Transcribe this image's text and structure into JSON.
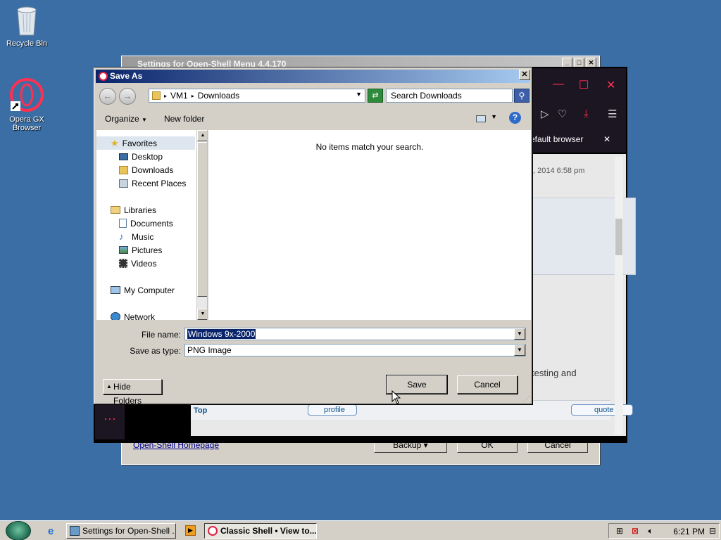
{
  "desktop": {
    "icons": [
      {
        "label": "Recycle Bin"
      },
      {
        "label": "Opera GX Browser"
      }
    ]
  },
  "settings_window": {
    "title": "Settings for Open-Shell Menu 4.4.170",
    "homepage_link": "Open-Shell Homepage",
    "backup_label": "Backup",
    "ok_label": "OK",
    "cancel_label": "Cancel"
  },
  "opera_window": {
    "banner_text": "efault browser",
    "date_text": ", 2014 6:58 pm",
    "body_text": "testing and",
    "top_link": "Top",
    "profile_label": "profile",
    "quote_label": "quote"
  },
  "save_as": {
    "title": "Save As",
    "close_label": "✕",
    "breadcrumb": [
      "VM1",
      "Downloads"
    ],
    "search_placeholder": "Search Downloads",
    "toolbar": {
      "organize": "Organize",
      "new_folder": "New folder"
    },
    "nav": {
      "favorites": "Favorites",
      "desktop": "Desktop",
      "downloads": "Downloads",
      "recent_places": "Recent Places",
      "libraries": "Libraries",
      "documents": "Documents",
      "music": "Music",
      "pictures": "Pictures",
      "videos": "Videos",
      "my_computer": "My Computer",
      "network": "Network"
    },
    "empty_message": "No items match your search.",
    "file_name_label": "File name:",
    "file_name_value": "Windows 9x-2000",
    "save_as_type_label": "Save as type:",
    "save_as_type_value": "PNG Image",
    "hide_folders_label": "Hide Folders",
    "save_label": "Save",
    "cancel_label": "Cancel"
  },
  "taskbar": {
    "items": [
      {
        "label": "Settings for Open-Shell ..."
      },
      {
        "label": "Classic Shell • View to..."
      }
    ],
    "clock": "6:21 PM"
  },
  "colors": {
    "desktop": "#3a6ea5",
    "dialog_face": "#d4d0c8",
    "titlebar_active": "#0a246a",
    "opera_accent": "#ff3050"
  }
}
